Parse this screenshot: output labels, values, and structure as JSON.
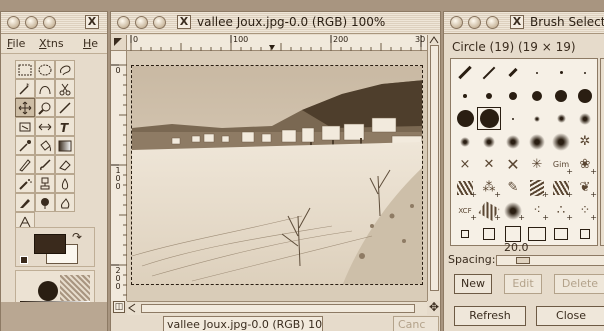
{
  "toolbox": {
    "menu": [
      "File",
      "Xtns",
      "He"
    ]
  },
  "image_window": {
    "title": "vallee Joux.jpg-0.0 (RGB) 100%",
    "hruler_labels": [
      "0",
      "100",
      "200",
      "30"
    ],
    "vruler_labels": [
      "0",
      "1\n0\n0",
      "2\n0\n0"
    ],
    "status": "vallee Joux.jpg-0.0 (RGB) 10",
    "cancel_label": "Canc"
  },
  "brush_window": {
    "title": "Brush Select",
    "brush_name": "Circle (19)  (19 × 19)",
    "spacing_value": "20.0",
    "spacing_value_fraction": 0.2,
    "spacing_label": "Spacing:",
    "new_label": "New",
    "edit_label": "Edit",
    "delete_label": "Delete",
    "refresh_label": "Refresh",
    "close_label": "Close"
  }
}
